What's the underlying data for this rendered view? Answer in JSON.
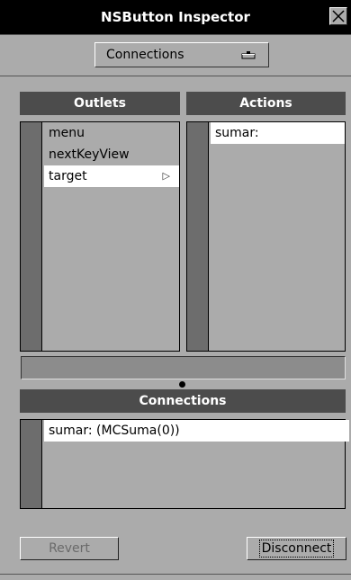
{
  "window": {
    "title": "NSButton Inspector"
  },
  "popup": {
    "selected": "Connections"
  },
  "outlets": {
    "header": "Outlets",
    "items": [
      {
        "label": "menu"
      },
      {
        "label": "nextKeyView"
      },
      {
        "label": "target",
        "selected": true,
        "arrow": "▷"
      }
    ]
  },
  "actions": {
    "header": "Actions",
    "items": [
      {
        "label": "sumar:",
        "selected": true
      }
    ]
  },
  "connections": {
    "header": "Connections",
    "items": [
      {
        "label": "sumar: (MCSuma(0))",
        "selected": true
      }
    ]
  },
  "buttons": {
    "revert": "Revert",
    "disconnect": "Disconnect"
  },
  "colors": {
    "background": "#ababab",
    "header": "#4c4c4c",
    "scroller": "#6d6d6d",
    "titlebar": "#000000",
    "selection": "#ffffff"
  }
}
